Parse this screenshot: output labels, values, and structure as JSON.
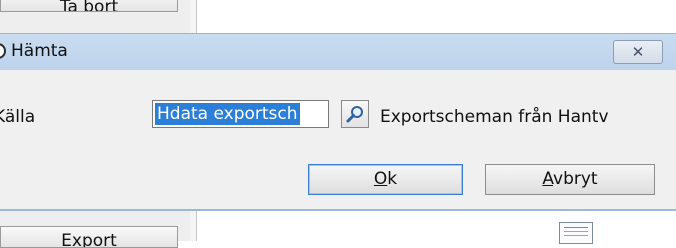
{
  "background": {
    "remove_button": "Ta bort",
    "export_button": "Export"
  },
  "dialog": {
    "title": "Hämta",
    "close_glyph": "☒",
    "source_label": "Källa",
    "source_value": "Hdata exportsch",
    "source_description": "Exportscheman från Hantv",
    "ok_mnemonic": "O",
    "ok_rest": "k",
    "cancel_mnemonic": "A",
    "cancel_rest": "vbryt"
  }
}
